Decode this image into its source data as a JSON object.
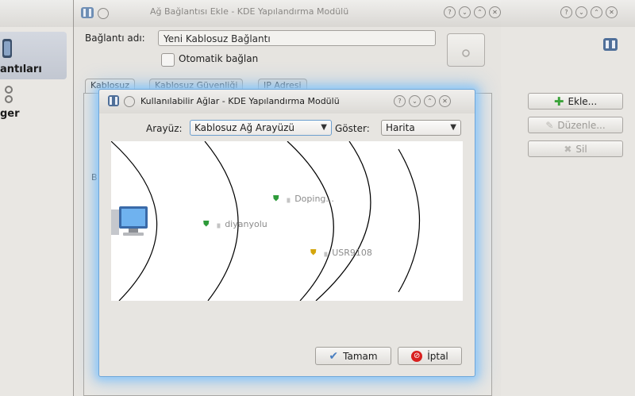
{
  "left_window": {
    "selected_item_label": "antıları",
    "item2_label": "ger"
  },
  "middle_window": {
    "title": "Ağ Bağlantısı Ekle - KDE Yapılandırma Modülü",
    "connection_name_label": "Bağlantı adı:",
    "connection_name_value": "Yeni Kablosuz Bağlantı",
    "auto_connect_label": "Otomatik bağlan",
    "auto_connect_checked": false,
    "tabs": [
      "Kablosuz",
      "Kablosuz Güvenliği",
      "IP Adresi"
    ],
    "side_label": "B"
  },
  "right_window": {
    "buttons": {
      "add": "Ekle...",
      "edit": "Düzenle...",
      "delete": "Sil"
    }
  },
  "dialog": {
    "title": "Kullanılabilir Ağlar - KDE Yapılandırma Modülü",
    "interface_label": "Arayüz:",
    "interface_value": "Kablosuz Ağ Arayüzü",
    "show_label": "Göster:",
    "show_value": "Harita",
    "networks": [
      {
        "name": "Doping...",
        "security_color": "#2e9b3a"
      },
      {
        "name": "diyanyolu",
        "security_color": "#2e9b3a"
      },
      {
        "name": "USR9108",
        "security_color": "#d4a60c"
      }
    ],
    "ok_label": "Tamam",
    "cancel_label": "İptal"
  },
  "colors": {
    "accent_glow": "#8cc8fa",
    "add_icon": "#3ba33b",
    "cancel_icon": "#d8201f",
    "ok_icon": "#4a7fc1"
  }
}
